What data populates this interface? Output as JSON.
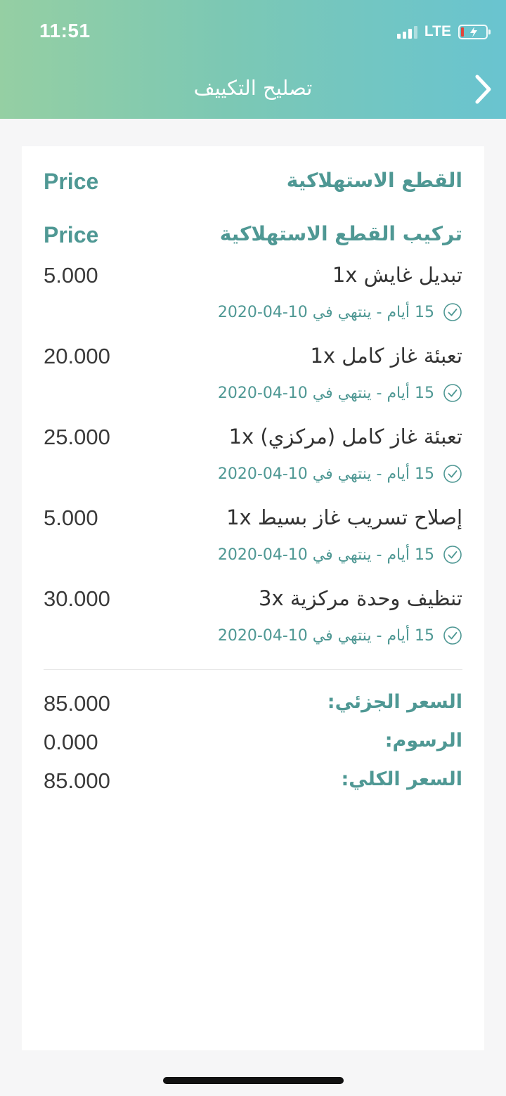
{
  "status_bar": {
    "time": "11:51",
    "network": "LTE"
  },
  "header": {
    "title": "تصليح التكييف"
  },
  "section1": {
    "label": "القطع الاستهلاكية",
    "price_label": "Price"
  },
  "section2": {
    "label": "تركيب القطع الاستهلاكية",
    "price_label": "Price"
  },
  "items": [
    {
      "name": "تبديل غايش 1x",
      "price": "5.000",
      "note": "15 أيام - ينتهي في 10-04-2020"
    },
    {
      "name": "تعبئة غاز كامل 1x",
      "price": "20.000",
      "note": "15 أيام - ينتهي في 10-04-2020"
    },
    {
      "name": "تعبئة غاز كامل (مركزي) 1x",
      "price": "25.000",
      "note": "15 أيام - ينتهي في 10-04-2020"
    },
    {
      "name": "إصلاح تسريب غاز بسيط 1x",
      "price": "5.000",
      "note": "15 أيام - ينتهي في 10-04-2020"
    },
    {
      "name": "تنظيف وحدة مركزية 3x",
      "price": "30.000",
      "note": "15 أيام - ينتهي في 10-04-2020"
    }
  ],
  "summary": {
    "subtotal_label": "السعر الجزئي:",
    "subtotal_value": "85.000",
    "fees_label": "الرسوم:",
    "fees_value": "0.000",
    "total_label": "السعر الكلي:",
    "total_value": "85.000"
  },
  "colors": {
    "accent": "#4f9894",
    "header_start": "#95cfa3",
    "header_end": "#69c4d0"
  },
  "icons": {
    "back": "chevron-right-icon",
    "item_status": "check-circle-icon"
  }
}
